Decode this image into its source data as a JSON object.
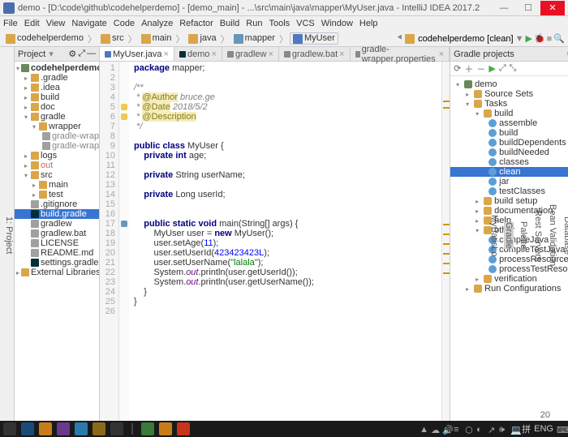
{
  "title": "demo - [D:\\code\\github\\codehelperdemo] - [demo_main] - ...\\src\\main\\java\\mapper\\MyUser.java - IntelliJ IDEA 2017.2",
  "menu": {
    "file": "File",
    "edit": "Edit",
    "view": "View",
    "navigate": "Navigate",
    "code": "Code",
    "analyze": "Analyze",
    "refactor": "Refactor",
    "build": "Build",
    "run": "Run",
    "tools": "Tools",
    "vcs": "VCS",
    "window": "Window",
    "help": "Help"
  },
  "breadcrumb": {
    "root": "codehelperdemo",
    "src": "src",
    "main": "main",
    "java": "java",
    "mapper": "mapper",
    "file": "MyUser"
  },
  "nav_right": {
    "config": "codehelperdemo [clean]"
  },
  "project": {
    "title": "Project",
    "root": "codehelperdemo [demo]",
    "items": [
      ".gradle",
      ".idea",
      "build",
      "doc",
      "gradle",
      "wrapper",
      "gradle-wrapper.j",
      "gradle-wrapper.p",
      "logs",
      "out",
      "src",
      "main",
      "test",
      ".gitignore",
      "build.gradle",
      "gradlew",
      "gradlew.bat",
      "LICENSE",
      "README.md",
      "settings.gradle"
    ],
    "external": "External Libraries"
  },
  "tabs": [
    {
      "label": "MyUser.java",
      "active": true
    },
    {
      "label": "demo",
      "active": false
    },
    {
      "label": "gradlew",
      "active": false
    },
    {
      "label": "gradlew.bat",
      "active": false
    },
    {
      "label": "gradle-wrapper.properties",
      "active": false
    }
  ],
  "code": {
    "lines": [
      "1",
      "2",
      "3",
      "4",
      "5",
      "6",
      "7",
      "8",
      "9",
      "10",
      "11",
      "12",
      "13",
      "14",
      "15",
      "16",
      "17",
      "18",
      "19",
      "20",
      "21",
      "22",
      "23",
      "24",
      "25",
      "26"
    ],
    "l1_kw": "package",
    "l1_t": " mapper;",
    "l3": "/**",
    "l4_a": "@Author",
    "l4_t": " bruce.ge",
    "l5_a": "@Date",
    "l5_t": " 2018/5/2",
    "l6_a": "@Description",
    "l7": " */",
    "l9a": "public class ",
    "l9b": "MyUser {",
    "l10a": "    private int ",
    "l10b": "age;",
    "l12a": "    private ",
    "l12b": "String userName;",
    "l14a": "    private ",
    "l14b": "Long userId;",
    "l17a": "    public static void ",
    "l17b": "main(String[] args) {",
    "l18a": "        MyUser user = ",
    "l18b": "new ",
    "l18c": "MyUser();",
    "l19a": "        user.setAge(",
    "l19b": "11",
    "l19c": ");",
    "l20a": "        user.setUserId(",
    "l20b": "423423423L",
    "l20c": ");",
    "l21a": "        user.setUserName(",
    "l21b": "\"lalala\"",
    "l21c": ");",
    "l22a": "        System.",
    "l22b": "out",
    "l22c": ".println(user.getUserId());",
    "l23a": "        System.",
    "l23b": "out",
    "l23c": ".println(user.getUserName());",
    "l24": "    }",
    "l25": "}"
  },
  "gradle": {
    "title": "Gradle projects",
    "root": "demo",
    "src": "Source Sets",
    "tasks": "Tasks",
    "grp_build": "build",
    "t_assemble": "assemble",
    "t_build": "build",
    "t_bd": "buildDependents",
    "t_bn": "buildNeeded",
    "t_cls": "classes",
    "t_clean": "clean",
    "t_jar": "jar",
    "t_tc": "testClasses",
    "grp_bs": "build setup",
    "grp_doc": "documentation",
    "grp_help": "help",
    "grp_other": "other",
    "t_cj": "compileJava",
    "t_ctj": "compileTestJava",
    "t_pr": "processResources",
    "t_ptr": "processTestResources",
    "grp_ver": "verification",
    "run": "Run Configurations"
  },
  "status": {
    "enc": "ENG",
    "sep": "拼"
  },
  "taskbar": {
    "time": "20"
  }
}
